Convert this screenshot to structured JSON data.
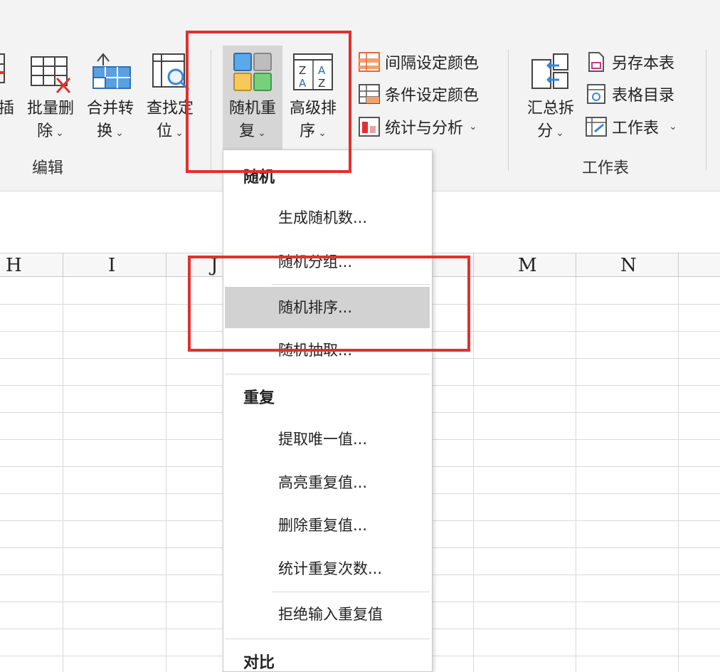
{
  "ribbon": {
    "tools": {
      "insert_partial": {
        "line1": "插",
        "line2": "⌄"
      },
      "batch_delete": {
        "line1": "批量删",
        "line2": "除"
      },
      "merge_convert": {
        "line1": "合并转",
        "line2": "换"
      },
      "find_locate": {
        "line1": "查找定",
        "line2": "位"
      },
      "random_repeat": {
        "line1": "随机重",
        "line2": "复"
      },
      "advanced_sort": {
        "line1": "高级排",
        "line2": "序"
      },
      "summary_split": {
        "line1": "汇总拆",
        "line2": "分"
      }
    },
    "small_commands": {
      "interval_color": "间隔设定颜色",
      "condition_color": "条件设定颜色",
      "stats_analysis": "统计与分析",
      "save_sheet": "另存本表",
      "table_index": "表格目录",
      "worksheet": "工作表"
    },
    "groups": {
      "edit": "编辑",
      "worksheet": "工作表"
    }
  },
  "sheet": {
    "columns": [
      "H",
      "I",
      "J",
      "M",
      "N"
    ]
  },
  "menu": {
    "random_header": "随机",
    "random_items": [
      "生成随机数...",
      "随机分组...",
      "随机排序...",
      "随机抽取..."
    ],
    "repeat_header": "重复",
    "repeat_items": [
      "提取唯一值...",
      "高亮重复值...",
      "删除重复值...",
      "统计重复次数...",
      "拒绝输入重复值"
    ],
    "compare_header": "对比",
    "selected_item": "随机排序..."
  },
  "colors": {
    "annotation_red": "#e03030",
    "ribbon_bg": "#f3f3f3",
    "menu_hover": "#d2d2d2"
  }
}
